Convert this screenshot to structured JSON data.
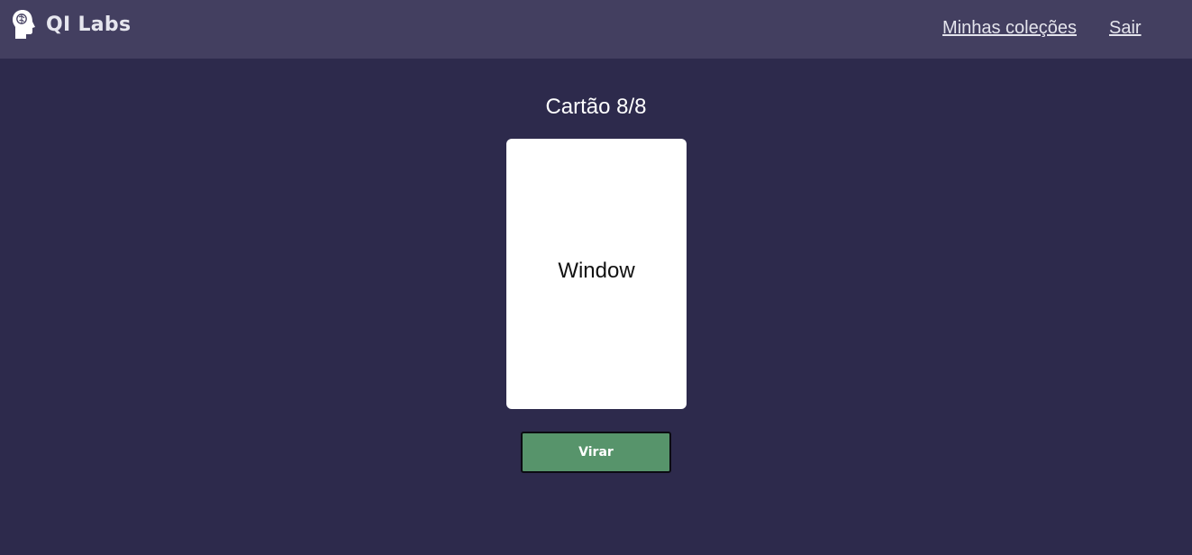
{
  "header": {
    "brand_name": "QI Labs",
    "brand_icon": "head-brain-icon",
    "nav": {
      "collections_label": "Minhas coleções",
      "logout_label": "Sair"
    }
  },
  "study": {
    "counter": "Cartão 8/8",
    "card_text": "Window",
    "flip_label": "Virar"
  },
  "colors": {
    "background": "#2d2a4c",
    "navbar": "#433f60",
    "card": "#ffffff",
    "flip_button": "#57946b"
  }
}
